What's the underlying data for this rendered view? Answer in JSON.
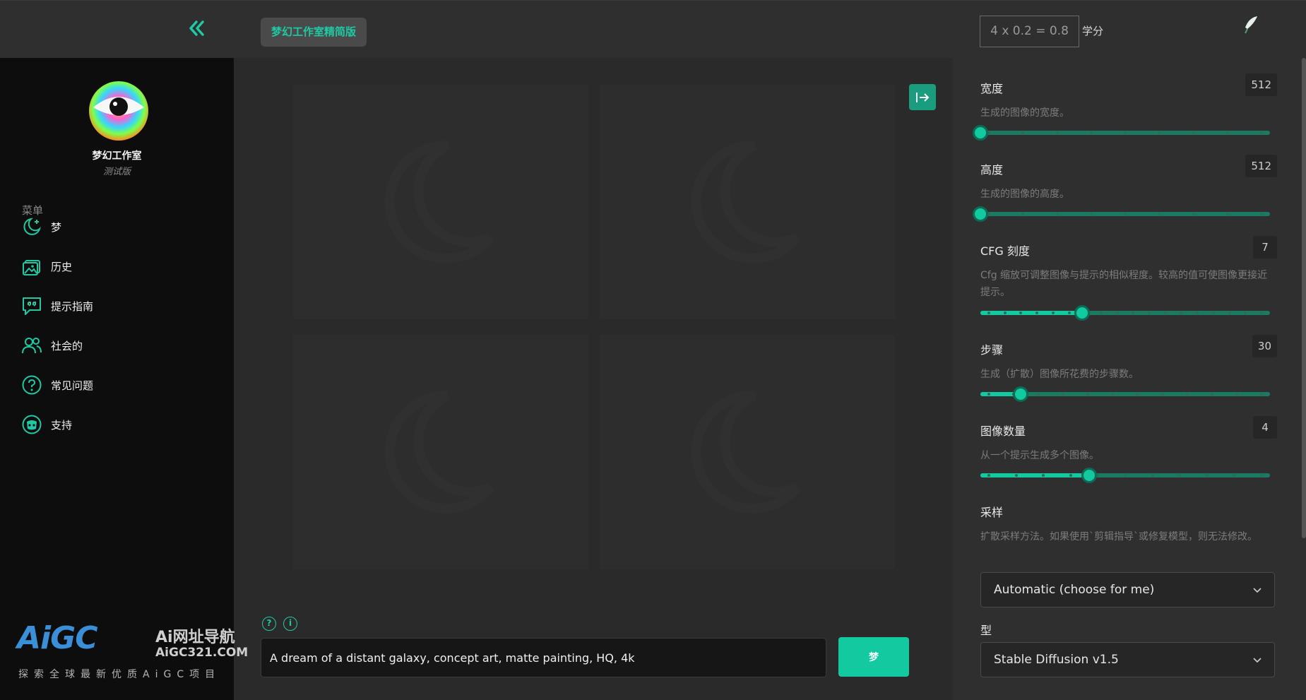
{
  "header": {
    "app_badge": "梦幻工作室精简版",
    "credits_expression": "4 x 0.2 = 0.8",
    "credits_label": "学分"
  },
  "sidebar": {
    "brand_name": "梦幻工作室",
    "brand_tag": "测试版",
    "menu_heading": "菜单",
    "items": [
      {
        "label": "梦",
        "icon": "moon-stars-icon"
      },
      {
        "label": "历史",
        "icon": "image-gallery-icon"
      },
      {
        "label": "提示指南",
        "icon": "quote-bubble-icon"
      },
      {
        "label": "社会的",
        "icon": "people-icon"
      },
      {
        "label": "常见问题",
        "icon": "question-circle-icon"
      },
      {
        "label": "支持",
        "icon": "discord-icon"
      }
    ]
  },
  "main": {
    "prompt_value": "A dream of a distant galaxy, concept art, matte painting, HQ, 4k",
    "dream_button": "梦"
  },
  "settings": {
    "width": {
      "title": "宽度",
      "value": "512",
      "desc": "生成的图像的宽度。",
      "fraction": 0.0
    },
    "height": {
      "title": "高度",
      "value": "512",
      "desc": "生成的图像的高度。",
      "fraction": 0.0
    },
    "cfg": {
      "title": "CFG 刻度",
      "value": "7",
      "desc": "Cfg 缩放可调整图像与提示的相似程度。较高的值可使图像更接近提示。",
      "fraction": 0.35
    },
    "steps": {
      "title": "步骤",
      "value": "30",
      "desc": "生成（扩散）图像所花费的步骤数。",
      "fraction": 0.14
    },
    "count": {
      "title": "图像数量",
      "value": "4",
      "desc": "从一个提示生成多个图像。",
      "fraction": 0.375
    },
    "sampler": {
      "title": "采样",
      "desc": "扩散采样方法。如果使用`剪辑指导`或修复模型，则无法修改。",
      "selected": "Automatic (choose for me)"
    },
    "model": {
      "title": "型",
      "selected": "Stable Diffusion v1.5"
    }
  },
  "watermark": {
    "logo_text": "AiGC",
    "cn_title": "Ai网址导航",
    "url": "AiGC321.COM",
    "slogan": "探索全球最新优质AiGC项目"
  },
  "colors": {
    "accent": "#13c9a0",
    "accent_dark": "#1b7a62",
    "sidebar_bg": "#0d0d0d",
    "panel_bg": "#2f2f2f"
  }
}
